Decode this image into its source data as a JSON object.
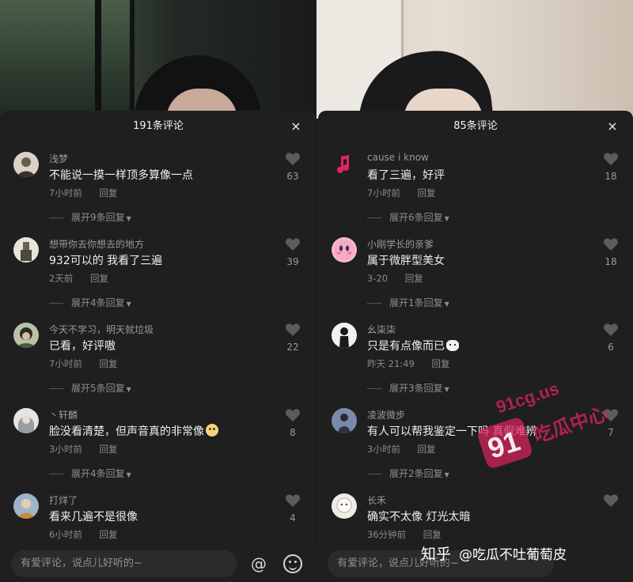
{
  "panels": [
    {
      "header": {
        "title": "191条评论",
        "close": "×"
      },
      "comments": [
        {
          "name": "浅梦",
          "text": "不能说一摸一样顶多算像一点",
          "time": "7小时前",
          "reply": "回复",
          "likes": "63",
          "expand": "展开9条回复",
          "avatar_color": "#b7a79a"
        },
        {
          "name": "想带你去你想去的地方",
          "text": "932可以的 我看了三遍",
          "time": "2天前",
          "reply": "回复",
          "likes": "39",
          "expand": "展开4条回复",
          "avatar_color": "#c9c3b4"
        },
        {
          "name": "今天不学习，明天就垃圾",
          "text": "已看，好评嗷",
          "time": "7小时前",
          "reply": "回复",
          "likes": "22",
          "expand": "展开5条回复",
          "avatar_color": "#8a9a7a"
        },
        {
          "name": "丶轩麟",
          "text": "脸没看清楚，但声音真的非常像",
          "time": "3小时前",
          "reply": "回复",
          "likes": "8",
          "expand": "展开4条回复",
          "avatar_color": "#d6d0cc"
        },
        {
          "name": "打烊了",
          "text": "看来几遍不是很像",
          "time": "6小时前",
          "reply": "回复",
          "likes": "4",
          "expand": "",
          "avatar_color": "#8aa0b8"
        }
      ],
      "input_placeholder": "有爱评论，说点儿好听的~",
      "at_symbol": "@"
    },
    {
      "header": {
        "title": "85条评论",
        "close": "×"
      },
      "comments": [
        {
          "name": "cause i know",
          "text": "看了三遍，好评",
          "time": "7小时前",
          "reply": "回复",
          "likes": "18",
          "expand": "展开6条回复",
          "avatar_color": "#e0245e"
        },
        {
          "name": "小刚学长的亲爹",
          "text": "属于微胖型美女",
          "time": "3-20",
          "reply": "回复",
          "likes": "18",
          "expand": "展开1条回复",
          "avatar_color": "#f4a6c0"
        },
        {
          "name": "幺柒柒",
          "text": "只是有点像而已",
          "time": "昨天 21:49",
          "reply": "回复",
          "likes": "6",
          "expand": "展开3条回复",
          "avatar_color": "#dcdcdc"
        },
        {
          "name": "凌波微步",
          "text": "有人可以帮我鉴定一下吗 真假难辨",
          "time": "3小时前",
          "reply": "回复",
          "likes": "7",
          "expand": "展开2条回复",
          "avatar_color": "#6a7a9a"
        },
        {
          "name": "长禾",
          "text": "确实不太像 灯光太暗",
          "time": "36分钟前",
          "reply": "回复",
          "likes": "",
          "expand": "",
          "avatar_color": "#e8e4dc"
        }
      ],
      "input_placeholder": "有爱评论，说点儿好听的~"
    }
  ],
  "watermark": {
    "site": "91cg.us",
    "slogan": "吃瓜中心",
    "logo": "91"
  },
  "zhihu": {
    "brand": "知乎",
    "handle": "@吃瓜不吐葡萄皮"
  },
  "colors": {
    "sheet_bg": "#1f1f20",
    "watermark_pink": "#e0245e"
  }
}
